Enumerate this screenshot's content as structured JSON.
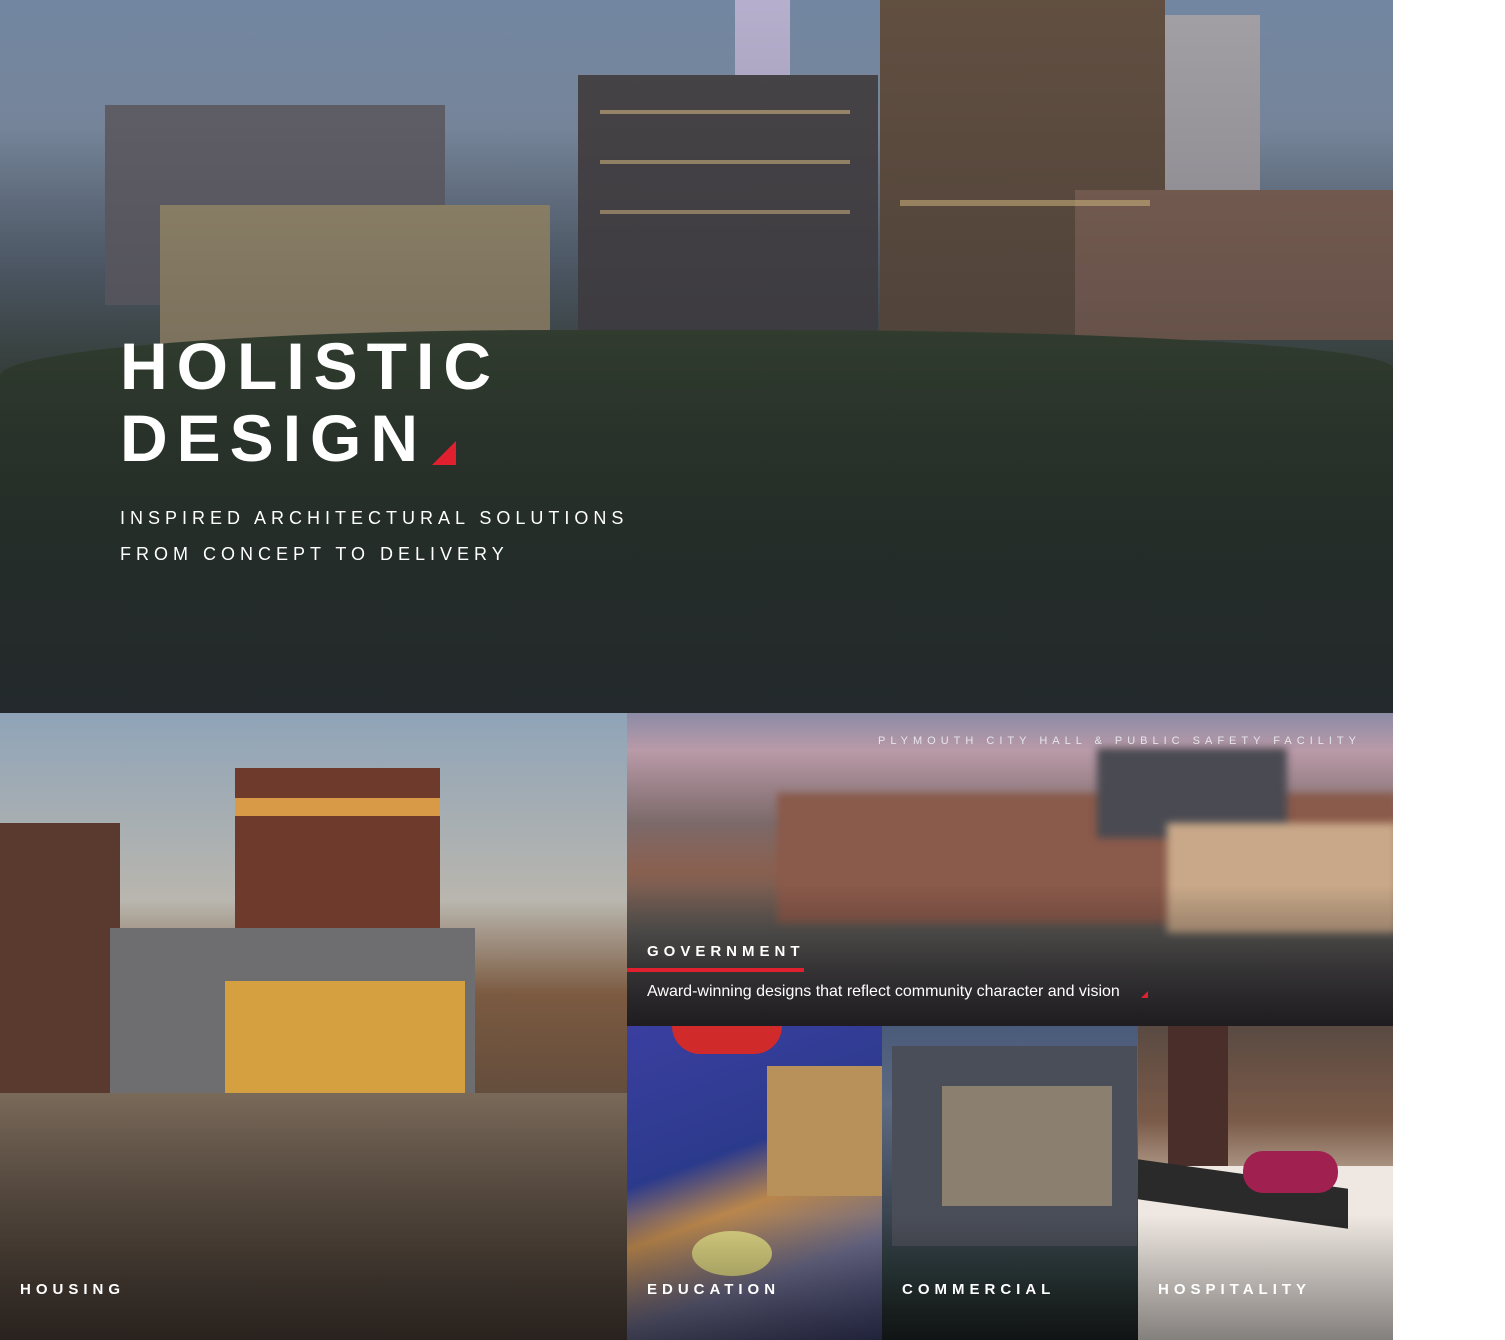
{
  "hero": {
    "title_line1": "HOLISTIC",
    "title_line2": "DESIGN",
    "subtitle_line1": "INSPIRED ARCHITECTURAL SOLUTIONS",
    "subtitle_line2": "FROM CONCEPT TO DELIVERY"
  },
  "categories": {
    "housing": {
      "label": "HOUSING"
    },
    "government": {
      "label": "GOVERNMENT",
      "caption": "PLYMOUTH CITY HALL & PUBLIC SAFETY FACILITY",
      "description": "Award-winning designs that reflect community character and vision"
    },
    "education": {
      "label": "EDUCATION"
    },
    "commercial": {
      "label": "COMMERCIAL"
    },
    "hospitality": {
      "label": "HOSPITALITY"
    }
  },
  "colors": {
    "accent": "#e0202e",
    "text": "#ffffff"
  }
}
